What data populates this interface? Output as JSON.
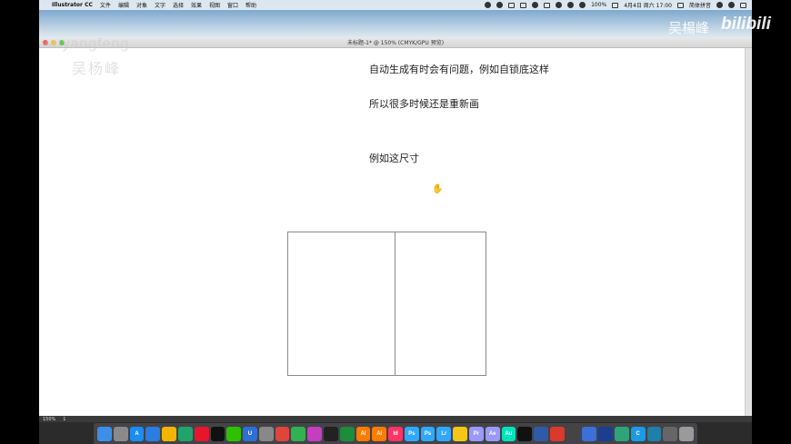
{
  "menubar": {
    "app_name": "Illustrator CC",
    "items": [
      "文件",
      "编辑",
      "对象",
      "文字",
      "选择",
      "效果",
      "视图",
      "窗口",
      "帮助"
    ],
    "battery": "100%",
    "datetime": "4月4日 周六 17:00",
    "input_method": "简体拼音"
  },
  "window": {
    "title": "未标题-1* @ 150% (CMYK/GPU 预览)"
  },
  "notes": {
    "line1": "自动生成有时会有问题，例如自锁底这样",
    "line2": "所以很多时候还是重新画",
    "line3": "例如这尺寸"
  },
  "statusbar": {
    "zoom": "150%",
    "page": "1"
  },
  "dock": {
    "apps": [
      {
        "name": "finder",
        "label": "",
        "color": "#3d8ee6"
      },
      {
        "name": "launchpad",
        "label": "",
        "color": "#8a8a8a"
      },
      {
        "name": "app-store",
        "label": "A",
        "color": "#1d8cf0"
      },
      {
        "name": "safari",
        "label": "",
        "color": "#2a7de1"
      },
      {
        "name": "chrome",
        "label": "",
        "color": "#f4b400"
      },
      {
        "name": "app-green",
        "label": "",
        "color": "#23a36c"
      },
      {
        "name": "weibo",
        "label": "",
        "color": "#e6162d"
      },
      {
        "name": "qq",
        "label": "",
        "color": "#111111"
      },
      {
        "name": "wechat",
        "label": "",
        "color": "#2dc100"
      },
      {
        "name": "u-app",
        "label": "U",
        "color": "#2d6fd6"
      },
      {
        "name": "system-preferences",
        "label": "",
        "color": "#888888"
      },
      {
        "name": "chrome-2",
        "label": "",
        "color": "#e0453a"
      },
      {
        "name": "app-round-green",
        "label": "",
        "color": "#32b150"
      },
      {
        "name": "itunes",
        "label": "",
        "color": "#c33fbf"
      },
      {
        "name": "app-dark",
        "label": "",
        "color": "#222222"
      },
      {
        "name": "app-green-2",
        "label": "",
        "color": "#1e8c3a"
      },
      {
        "name": "illustrator",
        "label": "Ai",
        "color": "#ff7c00"
      },
      {
        "name": "illustrator-2",
        "label": "Ai",
        "color": "#ff7c00"
      },
      {
        "name": "indesign",
        "label": "Id",
        "color": "#ff3366"
      },
      {
        "name": "photoshop",
        "label": "Ps",
        "color": "#31a8ff"
      },
      {
        "name": "photoshop-2",
        "label": "Ps",
        "color": "#31a8ff"
      },
      {
        "name": "lightroom",
        "label": "Lr",
        "color": "#31a8ff"
      },
      {
        "name": "photo-app",
        "label": "",
        "color": "#f5c518"
      },
      {
        "name": "premiere",
        "label": "Pr",
        "color": "#9999ff"
      },
      {
        "name": "after-effects",
        "label": "Ae",
        "color": "#9999ff"
      },
      {
        "name": "audition",
        "label": "Au",
        "color": "#00e4bb"
      },
      {
        "name": "app-black",
        "label": "",
        "color": "#111111"
      },
      {
        "name": "cinema-app",
        "label": "",
        "color": "#2f5aa8"
      },
      {
        "name": "app-red",
        "label": "",
        "color": "#d93a2b"
      },
      {
        "name": "inkscape",
        "label": "",
        "color": "#444444"
      },
      {
        "name": "app-blue",
        "label": "",
        "color": "#3c6fd8"
      },
      {
        "name": "app-navy",
        "label": "",
        "color": "#1b3f8f"
      },
      {
        "name": "app-mint",
        "label": "",
        "color": "#2fa37a"
      },
      {
        "name": "app-c",
        "label": "C",
        "color": "#1a9be6"
      },
      {
        "name": "app-teal",
        "label": "",
        "color": "#1f7fa8"
      },
      {
        "name": "preview",
        "label": "",
        "color": "#666666"
      },
      {
        "name": "trash",
        "label": "",
        "color": "#9a9a9a"
      }
    ]
  },
  "watermark": {
    "name_en": "wuyangfeng",
    "name_cn": "吴杨峰",
    "bili_name": "吴楊峰",
    "bili_logo": "bilibili"
  }
}
